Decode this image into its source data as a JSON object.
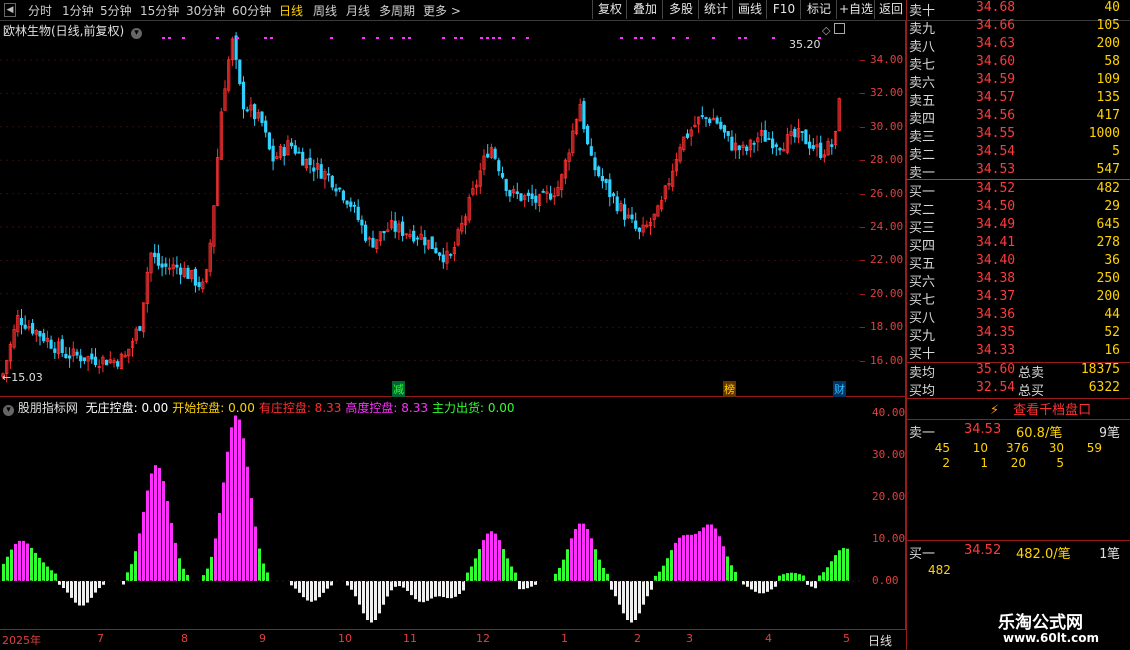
{
  "toolbar": {
    "tabs": [
      "分时",
      "1分钟",
      "5分钟",
      "15分钟",
      "30分钟",
      "60分钟",
      "日线",
      "周线",
      "月线",
      "多周期",
      "更多 >"
    ],
    "active_tab": "日线",
    "buttons": [
      "复权",
      "叠加",
      "多股",
      "统计",
      "画线",
      "F10",
      "标记",
      "+自选",
      "返回"
    ]
  },
  "main_chart": {
    "title": "欧林生物(日线,前复权)",
    "high_label": "35.20",
    "low_label": "←15.03",
    "y_ticks": [
      "34.00",
      "32.00",
      "30.00",
      "28.00",
      "26.00",
      "24.00",
      "22.00",
      "20.00",
      "18.00",
      "16.00"
    ],
    "markers": [
      "减",
      "榜",
      "财"
    ]
  },
  "indicator": {
    "name": "股朋指标网",
    "items": [
      {
        "label": "无庄控盘: 0.00",
        "color": "#ffffff"
      },
      {
        "label": "开始控盘: 0.00",
        "color": "#ffd400"
      },
      {
        "label": "有庄控盘: 8.33",
        "color": "#ff3030"
      },
      {
        "label": "高度控盘: 8.33",
        "color": "#ff30ff"
      },
      {
        "label": "主力出货: 0.00",
        "color": "#30ff30"
      }
    ],
    "y_ticks": [
      "40.00",
      "30.00",
      "20.00",
      "10.00",
      "0.00"
    ]
  },
  "date_axis": {
    "labels": [
      "2025年",
      "7",
      "8",
      "9",
      "10",
      "11",
      "12",
      "1",
      "2",
      "3",
      "4",
      "5"
    ],
    "period": "日线"
  },
  "orderbook": {
    "asks": [
      {
        "label": "卖十",
        "price": "34.68",
        "vol": "40"
      },
      {
        "label": "卖九",
        "price": "34.66",
        "vol": "105"
      },
      {
        "label": "卖八",
        "price": "34.63",
        "vol": "200"
      },
      {
        "label": "卖七",
        "price": "34.60",
        "vol": "58"
      },
      {
        "label": "卖六",
        "price": "34.59",
        "vol": "109"
      },
      {
        "label": "卖五",
        "price": "34.57",
        "vol": "135"
      },
      {
        "label": "卖四",
        "price": "34.56",
        "vol": "417"
      },
      {
        "label": "卖三",
        "price": "34.55",
        "vol": "1000"
      },
      {
        "label": "卖二",
        "price": "34.54",
        "vol": "5"
      },
      {
        "label": "卖一",
        "price": "34.53",
        "vol": "547"
      }
    ],
    "bids": [
      {
        "label": "买一",
        "price": "34.52",
        "vol": "482"
      },
      {
        "label": "买二",
        "price": "34.50",
        "vol": "29"
      },
      {
        "label": "买三",
        "price": "34.49",
        "vol": "645"
      },
      {
        "label": "买四",
        "price": "34.41",
        "vol": "278"
      },
      {
        "label": "买五",
        "price": "34.40",
        "vol": "36"
      },
      {
        "label": "买六",
        "price": "34.38",
        "vol": "250"
      },
      {
        "label": "买七",
        "price": "34.37",
        "vol": "200"
      },
      {
        "label": "买八",
        "price": "34.36",
        "vol": "44"
      },
      {
        "label": "买九",
        "price": "34.35",
        "vol": "52"
      },
      {
        "label": "买十",
        "price": "34.33",
        "vol": "16"
      }
    ],
    "ask_avg": {
      "label": "卖均",
      "price": "35.60",
      "total_label": "总卖",
      "total": "18375"
    },
    "bid_avg": {
      "label": "买均",
      "price": "32.54",
      "total_label": "总买",
      "total": "6322"
    },
    "depth_button": "查看千档盘口",
    "ask1_queue": {
      "label": "卖一",
      "price": "34.53",
      "per": "60.8/笔",
      "count": "9笔",
      "row1": [
        "45",
        "10",
        "376",
        "30",
        "59"
      ],
      "row2": [
        "2",
        "1",
        "20",
        "5"
      ]
    },
    "bid1_queue": {
      "label": "买一",
      "price": "34.52",
      "per": "482.0/笔",
      "count": "1笔",
      "row1": [
        "482"
      ]
    }
  },
  "watermark": {
    "line1": "乐淘公式网",
    "line2": "www.60lt.com"
  },
  "colors": {
    "up": "#ff3030",
    "down": "#30d0ff",
    "accent": "#ffd400",
    "magenta": "#ff30ff",
    "green": "#30ff30"
  }
}
